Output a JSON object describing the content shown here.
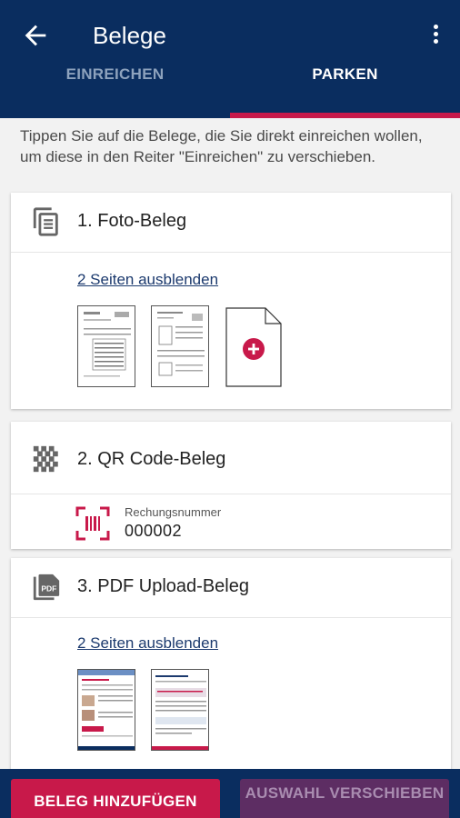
{
  "header": {
    "title": "Belege",
    "tabs": [
      {
        "label": "EINREICHEN"
      },
      {
        "label": "PARKEN"
      }
    ]
  },
  "hint": "Tippen Sie auf die Belege, die Sie direkt einreichen wollen, um diese in den Reiter \"Einreichen\" zu verschieben.",
  "receipts": [
    {
      "title": "1. Foto-Beleg",
      "toggle_label": "2 Seiten ausblenden",
      "icon": "document-icon"
    },
    {
      "title": "2. QR Code-Beleg",
      "field_label": "Rechungsnummer",
      "field_value": "000002",
      "icon": "qr-code-icon"
    },
    {
      "title": "3. PDF Upload-Beleg",
      "toggle_label": "2 Seiten ausblenden",
      "icon": "pdf-icon"
    }
  ],
  "actions": {
    "add_label": "BELEG HINZUFÜGEN",
    "move_label": "AUSWAHL VERSCHIEBEN"
  },
  "colors": {
    "primary": "#0a2d5f",
    "accent": "#c8194a",
    "disabled_button": "#5d2d63"
  }
}
